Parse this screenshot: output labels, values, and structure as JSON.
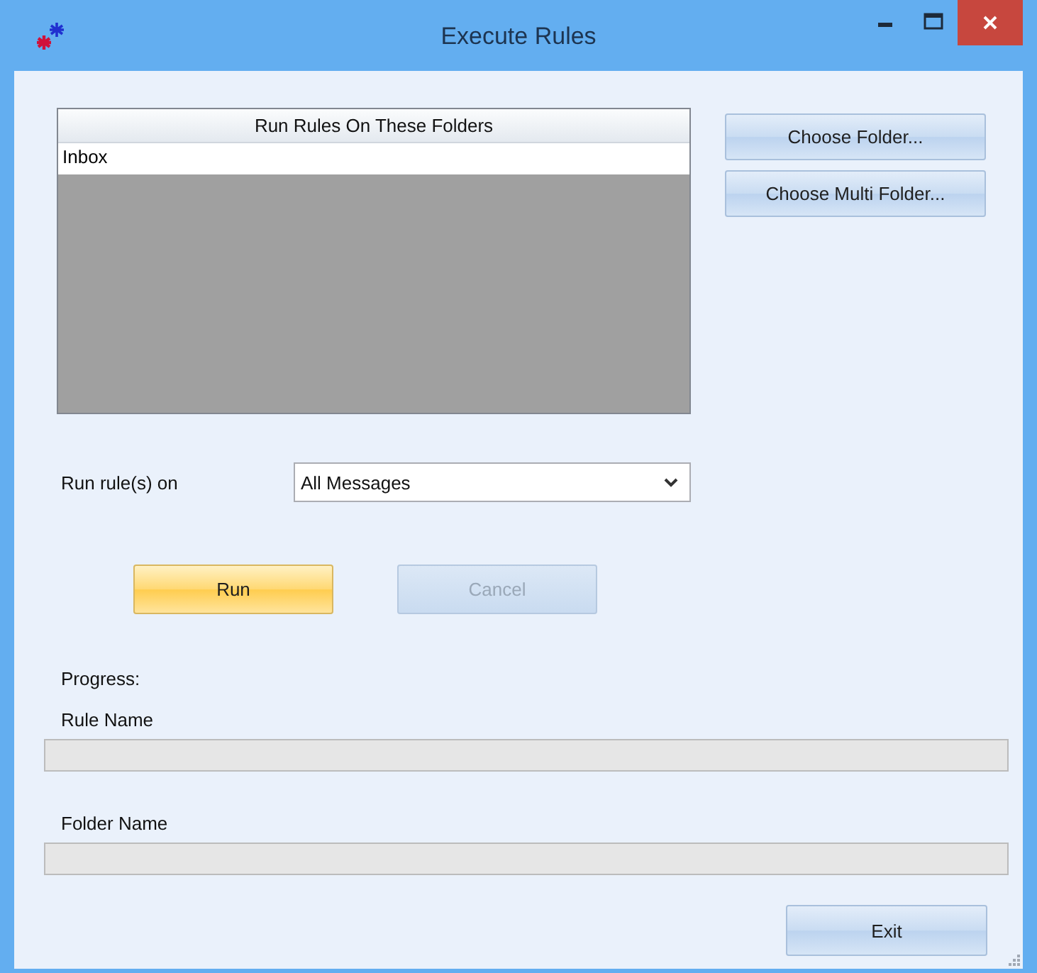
{
  "window": {
    "title": "Execute Rules"
  },
  "folder_list": {
    "header": "Run Rules On These Folders",
    "rows": [
      {
        "label": "Inbox",
        "selected": false
      }
    ]
  },
  "folder_buttons": [
    {
      "label": "Choose Folder...",
      "disabled": false,
      "focused": false
    },
    {
      "label": "Choose Multi Folder...",
      "disabled": false,
      "focused": false
    }
  ],
  "run_on": {
    "label": "Run rule(s) on",
    "value": "All Messages"
  },
  "action_buttons": [
    {
      "label": "Run",
      "disabled": false,
      "focused": true
    },
    {
      "label": "Cancel",
      "disabled": true,
      "focused": false
    }
  ],
  "progress": {
    "label": "Progress:",
    "bars": [
      {
        "label": "Rule Name",
        "level": 0
      },
      {
        "label": "Folder Name",
        "level": 0
      }
    ]
  },
  "exit_button": {
    "label": "Exit",
    "disabled": false,
    "focused": false
  }
}
